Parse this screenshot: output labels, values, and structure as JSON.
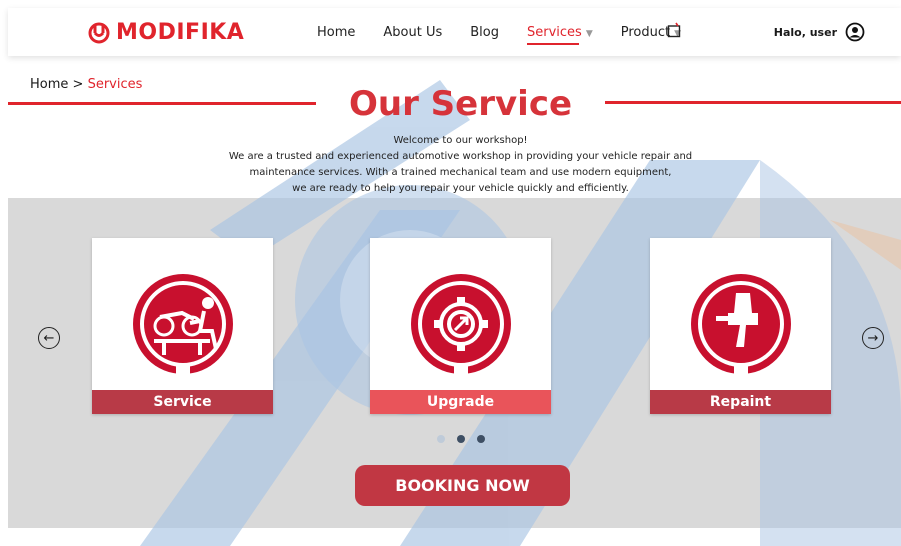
{
  "brand": {
    "name": "MODIFIKA",
    "color": "#e0242c"
  },
  "nav": {
    "items": [
      {
        "label": "Home"
      },
      {
        "label": "About Us"
      },
      {
        "label": "Blog"
      },
      {
        "label": "Services",
        "active": true
      },
      {
        "label": "Product"
      }
    ],
    "cart_icon": "shopping-bag-icon"
  },
  "user": {
    "greeting": "Halo, user",
    "icon": "user-circle-icon"
  },
  "breadcrumb": {
    "home": "Home >",
    "current": "Services"
  },
  "section": {
    "title": "Our Service",
    "intro_1": "Welcome to our workshop!",
    "intro_2": "We are a trusted and experienced automotive workshop in providing your vehicle repair and",
    "intro_3": "maintenance services. With a trained mechanical team and use modern equipment,",
    "intro_4": "we are ready to help you repair your vehicle quickly and efficiently."
  },
  "carousel": {
    "cards": [
      {
        "label": "Service",
        "icon": "motorcycle-repair-icon"
      },
      {
        "label": "Upgrade",
        "icon": "gear-upgrade-icon"
      },
      {
        "label": "Repaint",
        "icon": "spray-gun-icon"
      }
    ],
    "prev_icon": "arrow-left-circle-icon",
    "next_icon": "arrow-right-circle-icon",
    "active_dot": 1,
    "dot_count": 3
  },
  "cta": {
    "label": "BOOKING NOW"
  }
}
